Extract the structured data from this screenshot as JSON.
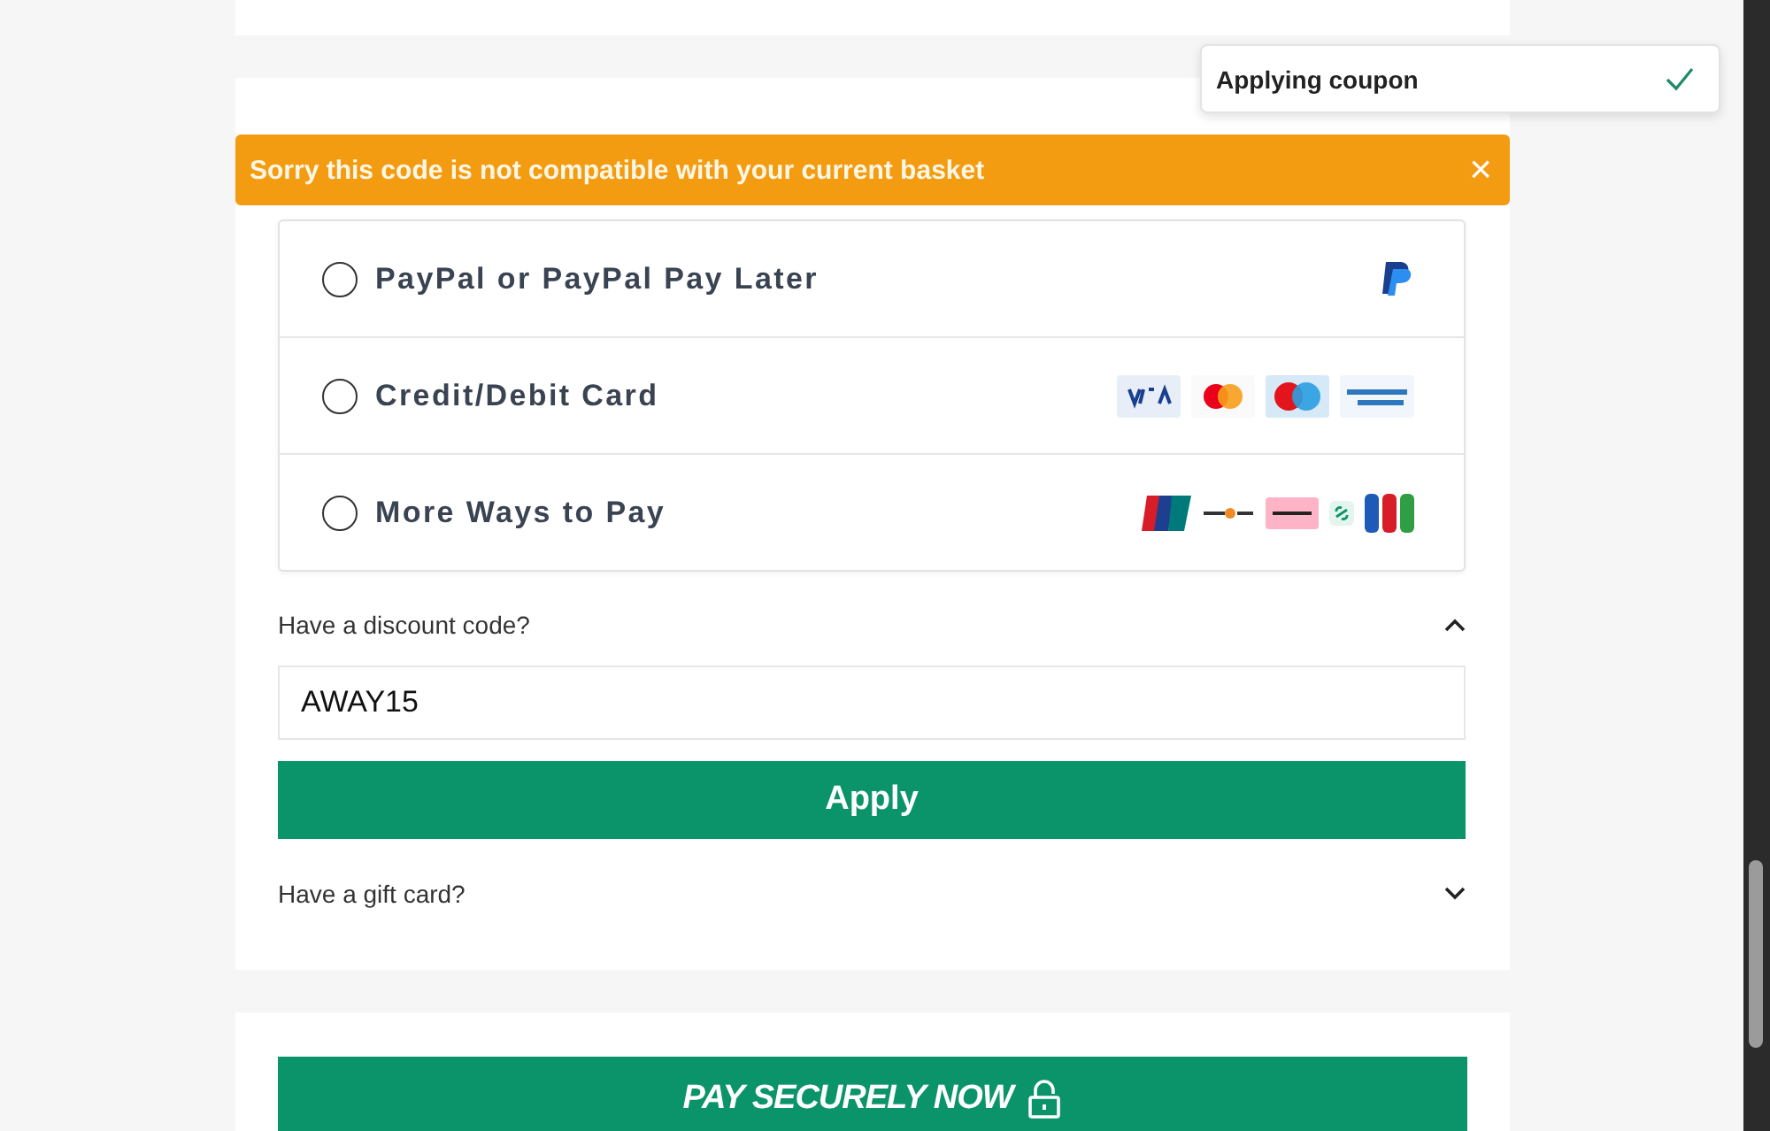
{
  "toast": {
    "message": "Applying coupon",
    "done": true
  },
  "alert": {
    "message": "Sorry this code is not compatible with your current basket",
    "close": "×"
  },
  "payment_methods": [
    {
      "kind": "paypal",
      "label": "PayPal or PayPal Pay Later",
      "selected": false
    },
    {
      "kind": "card",
      "label": "Credit/Debit Card",
      "selected": false
    },
    {
      "kind": "other",
      "label": "More Ways to Pay",
      "selected": false
    }
  ],
  "discount": {
    "label": "Have a discount code?",
    "expanded": true,
    "value": "AWAY15",
    "button": "Apply"
  },
  "gift_card": {
    "label": "Have a gift card?",
    "expanded": false
  },
  "pay_button": {
    "label": "PAY SECURELY NOW"
  }
}
